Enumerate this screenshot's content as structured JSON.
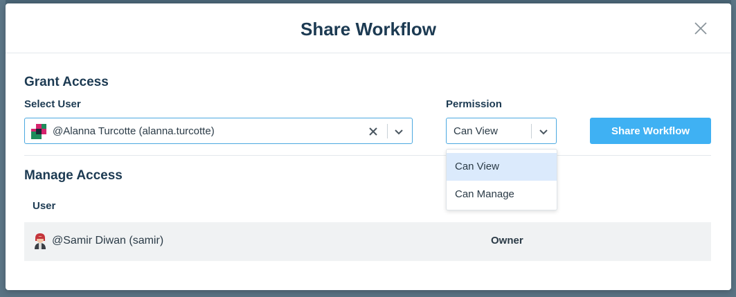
{
  "modal": {
    "title": "Share Workflow",
    "close_label": "close"
  },
  "grant_access": {
    "heading": "Grant Access",
    "select_user_label": "Select User",
    "selected_user": "@Alanna Turcotte (alanna.turcotte)",
    "permission_label": "Permission",
    "permission_value": "Can View",
    "share_button": "Share Workflow"
  },
  "permission_options": [
    {
      "label": "Can View",
      "selected": true
    },
    {
      "label": "Can Manage",
      "selected": false
    }
  ],
  "manage_access": {
    "heading": "Manage Access",
    "columns": [
      "User"
    ],
    "rows": [
      {
        "user": "@Samir Diwan (samir)",
        "role": "Owner"
      }
    ]
  },
  "colors": {
    "accent": "#3fb1f3",
    "focus_border": "#4aa8e0",
    "title_text": "#1c3a52",
    "option_highlight": "#dbeafc"
  },
  "icons": {
    "close": "close-icon",
    "clear": "clear-x-icon",
    "chevron": "chevron-down-icon",
    "user_avatar": "avatar-icon"
  }
}
